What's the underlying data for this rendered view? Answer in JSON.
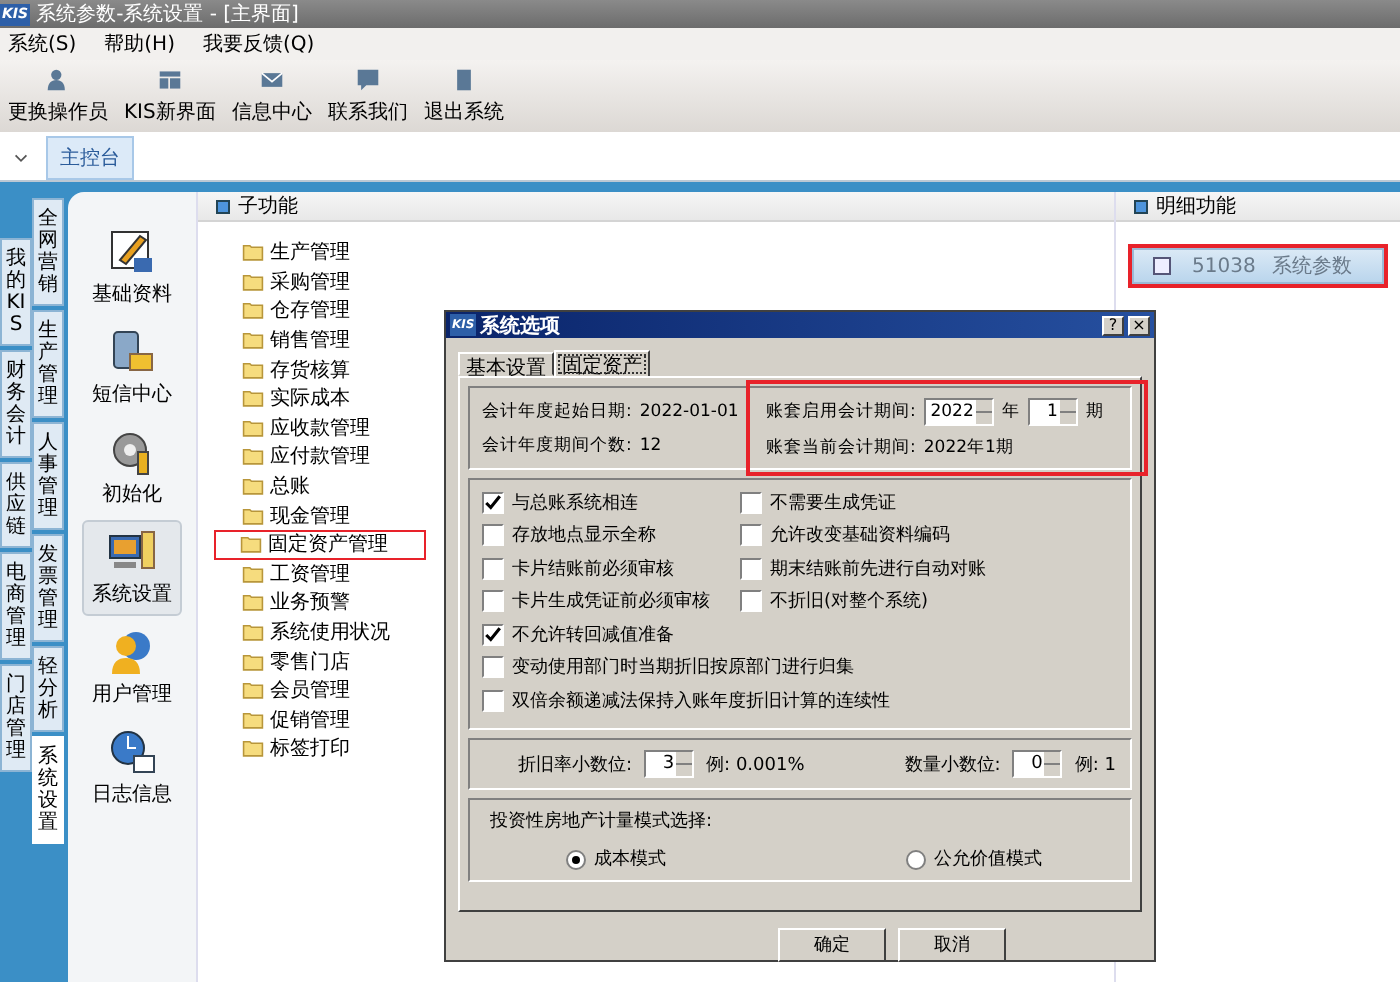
{
  "window": {
    "app_badge": "KIS",
    "title": "系统参数-系统设置 - [主界面]"
  },
  "menu": [
    "系统(S)",
    "帮助(H)",
    "我要反馈(Q)"
  ],
  "toolbar": [
    {
      "label": "更换操作员",
      "kind": "user"
    },
    {
      "label": "KIS新界面",
      "kind": "layout"
    },
    {
      "label": "信息中心",
      "kind": "mail"
    },
    {
      "label": "联系我们",
      "kind": "chat"
    },
    {
      "label": "退出系统",
      "kind": "exit"
    }
  ],
  "tabs": [
    {
      "label": "主控台",
      "selected": true
    }
  ],
  "module_tabs": {
    "outer": [
      {
        "label": "我的KIS",
        "selected": false
      },
      {
        "label": "财务会计",
        "selected": false
      },
      {
        "label": "供应链",
        "selected": false
      },
      {
        "label": "电商管理",
        "selected": false
      },
      {
        "label": "门店管理",
        "selected": false
      }
    ],
    "inner": [
      {
        "label": "全网营销",
        "selected": false
      },
      {
        "label": "生产管理",
        "selected": false
      },
      {
        "label": "人事管理",
        "selected": false
      },
      {
        "label": "发票管理",
        "selected": false
      },
      {
        "label": "轻分析",
        "selected": false
      },
      {
        "label": "系统设置",
        "selected": true
      }
    ]
  },
  "sidebar": [
    {
      "label": "基础资料",
      "kind": "edit",
      "selected": false
    },
    {
      "label": "短信中心",
      "kind": "sms",
      "selected": false
    },
    {
      "label": "初始化",
      "kind": "gear",
      "selected": false
    },
    {
      "label": "系统设置",
      "kind": "computer",
      "selected": true
    },
    {
      "label": "用户管理",
      "kind": "user",
      "selected": false
    },
    {
      "label": "日志信息",
      "kind": "clock",
      "selected": false
    }
  ],
  "subfunctions": {
    "title": "子功能",
    "items": [
      {
        "label": "生产管理",
        "selected": false
      },
      {
        "label": "采购管理",
        "selected": false
      },
      {
        "label": "仓存管理",
        "selected": false
      },
      {
        "label": "销售管理",
        "selected": false
      },
      {
        "label": "存货核算",
        "selected": false
      },
      {
        "label": "实际成本",
        "selected": false
      },
      {
        "label": "应收款管理",
        "selected": false
      },
      {
        "label": "应付款管理",
        "selected": false
      },
      {
        "label": "总账",
        "selected": false
      },
      {
        "label": "现金管理",
        "selected": false
      },
      {
        "label": "固定资产管理",
        "selected": true
      },
      {
        "label": "工资管理",
        "selected": false
      },
      {
        "label": "业务预警",
        "selected": false
      },
      {
        "label": "系统使用状况",
        "selected": false
      },
      {
        "label": "零售门店",
        "selected": false
      },
      {
        "label": "会员管理",
        "selected": false
      },
      {
        "label": "促销管理",
        "selected": false
      },
      {
        "label": "标签打印",
        "selected": false
      }
    ]
  },
  "details": {
    "title": "明细功能",
    "items": [
      {
        "code": "51038",
        "label": "系统参数",
        "selected": true
      }
    ]
  },
  "dialog": {
    "app_badge": "KIS",
    "title": "系统选项",
    "help": "?",
    "close": "×",
    "tabs": [
      {
        "label": "基本设置",
        "selected": false
      },
      {
        "label": "固定资产",
        "selected": true
      }
    ],
    "start_date_label": "会计年度起始日期:",
    "start_date": "2022-01-01",
    "period_count_label": "会计年度期间个数:",
    "period_count": "12",
    "period": {
      "highlighted": true,
      "start_label": "账套启用会计期间:",
      "year": "2022",
      "year_unit": "年",
      "period": "1",
      "period_unit": "期",
      "current_label": "账套当前会计期间:",
      "current": "2022年1期"
    },
    "option_rows": [
      {
        "left": {
          "label": "与总账系统相连",
          "checked": true
        },
        "right": {
          "label": "不需要生成凭证",
          "checked": false
        }
      },
      {
        "left": {
          "label": "存放地点显示全称",
          "checked": false
        },
        "right": {
          "label": "允许改变基础资料编码",
          "checked": false
        }
      },
      {
        "left": {
          "label": "卡片结账前必须审核",
          "checked": false
        },
        "right": {
          "label": "期末结账前先进行自动对账",
          "checked": false
        }
      },
      {
        "left": {
          "label": "卡片生成凭证前必须审核",
          "checked": false
        },
        "right": {
          "label": "不折旧(对整个系统)",
          "checked": false
        }
      },
      {
        "left": {
          "label": "不允许转回减值准备",
          "checked": true
        }
      },
      {
        "left": {
          "label": "变动使用部门时当期折旧按原部门进行归集",
          "checked": false
        }
      },
      {
        "left": {
          "label": "双倍余额递减法保持入账年度折旧计算的连续性",
          "checked": false
        }
      }
    ],
    "decimals": [
      {
        "label": "折旧率小数位:",
        "value": "3",
        "example": "例: 0.001%"
      },
      {
        "label": "数量小数位:",
        "value": "0",
        "example": "例: 1"
      }
    ],
    "property_mode": {
      "label": "投资性房地产计量模式选择:",
      "options": [
        {
          "label": "成本模式",
          "selected": true
        },
        {
          "label": "公允价值模式",
          "selected": false
        }
      ]
    },
    "buttons": [
      "确定",
      "取消"
    ]
  }
}
